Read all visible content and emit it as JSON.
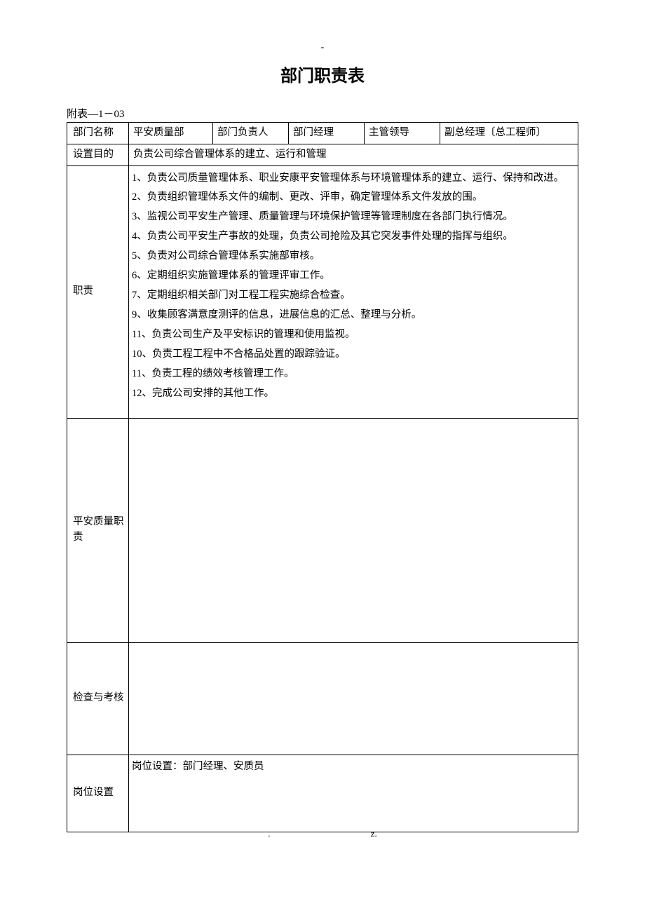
{
  "header": {
    "dash": "-",
    "title": "部门职责表",
    "ref": "附表—1－03"
  },
  "row1": {
    "label": "部门名称",
    "v1": "平安质量部",
    "v2": "部门负责人",
    "v3": "部门经理",
    "v4": "主管领导",
    "v5": "副总经理〔总工程师〕"
  },
  "row2": {
    "label": "设置目的",
    "value": "负责公司综合管理体系的建立、运行和管理"
  },
  "duties": {
    "label": "职责",
    "items": [
      "1、负责公司质量管理体系、职业安康平安管理体系与环境管理体系的建立、运行、保持和改进。",
      "2、负责组织管理体系文件的编制、更改、评审，确定管理体系文件发放的围。",
      "3、监视公司平安生产管理、质量管理与环境保护管理等管理制度在各部门执行情况。",
      "4、负责公司平安生产事故的处理，负责公司抢险及其它突发事件处理的指挥与组织。",
      "5、负责对公司综合管理体系实施部审核。",
      "6、定期组织实施管理体系的管理评审工作。",
      "7、定期组织相关部门对工程工程实施综合检查。",
      "9、收集顾客满意度测评的信息，进展信息的汇总、整理与分析。",
      "11、负责公司生产及平安标识的管理和使用监视。",
      "10、负责工程工程中不合格品处置的跟踪验证。",
      "11、负责工程的绩效考核管理工作。",
      "12、完成公司安排的其他工作。"
    ]
  },
  "safetyQuality": {
    "label": "平安质量职责",
    "value": ""
  },
  "inspection": {
    "label": "检查与考核",
    "value": ""
  },
  "positions": {
    "label": "岗位设置",
    "value": "岗位设置：部门经理、安质员"
  },
  "footer": {
    "left": ".",
    "right": "z."
  }
}
